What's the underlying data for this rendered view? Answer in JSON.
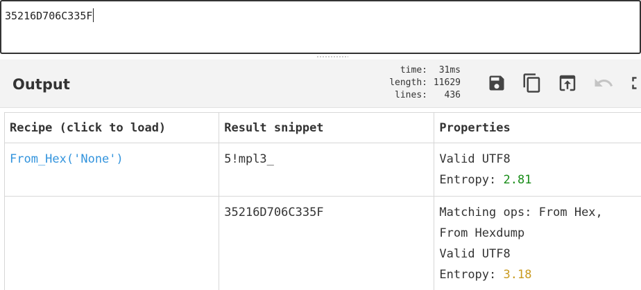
{
  "input": {
    "value": "35216D706C335F"
  },
  "output": {
    "title": "Output",
    "stats": [
      {
        "label": "time:",
        "value": "31ms"
      },
      {
        "label": "length:",
        "value": "11629"
      },
      {
        "label": "lines:",
        "value": "436"
      }
    ],
    "toolbar": {
      "save_icon": "save-icon",
      "copy_icon": "copy-icon",
      "replace_input_icon": "replace-input-icon",
      "undo_icon": "undo-icon",
      "maximise_icon": "maximise-icon"
    }
  },
  "table": {
    "headers": [
      "Recipe (click to load)",
      "Result snippet",
      "Properties"
    ],
    "rows": [
      {
        "recipe": "From_Hex('None')",
        "snippet": "5!mpl3_",
        "properties": [
          "Valid UTF8"
        ],
        "entropy_label": "Entropy: ",
        "entropy_value": "2.81",
        "entropy_color": "#178c17"
      },
      {
        "recipe": "",
        "snippet": "35216D706C335F",
        "properties": [
          "Matching ops: From Hex,",
          "From Hexdump",
          "Valid UTF8"
        ],
        "entropy_label": "Entropy: ",
        "entropy_value": "3.18",
        "entropy_color": "#c99a1f"
      }
    ]
  }
}
